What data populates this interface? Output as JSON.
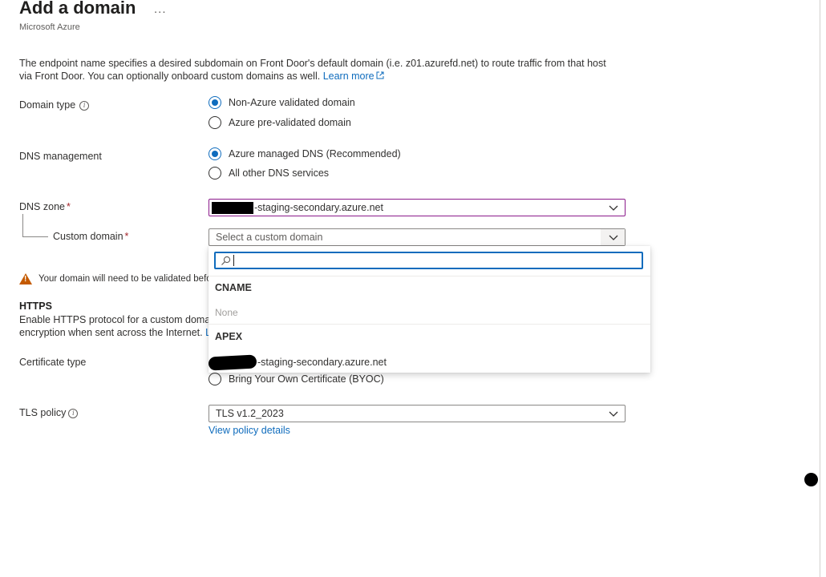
{
  "header": {
    "title": "Add a domain",
    "more_label": "...",
    "subtitle": "Microsoft Azure"
  },
  "description": {
    "text": "The endpoint name specifies a desired subdomain on Front Door's default domain (i.e. z01.azurefd.net) to route traffic from that host via Front Door. You can optionally onboard custom domains as well.",
    "learn_more": "Learn more"
  },
  "domain_type": {
    "label": "Domain type",
    "options": [
      "Non-Azure validated domain",
      "Azure pre-validated domain"
    ],
    "selected": "Non-Azure validated domain"
  },
  "dns_management": {
    "label": "DNS management",
    "options": [
      "Azure managed DNS (Recommended)",
      "All other DNS services"
    ],
    "selected": "Azure managed DNS (Recommended)"
  },
  "dns_zone": {
    "label": "DNS zone",
    "required_mark": "*",
    "value_suffix": "-staging-secondary.azure.net"
  },
  "custom_domain": {
    "label": "Custom domain",
    "required_mark": "*",
    "placeholder": "Select a custom domain",
    "dropdown": {
      "search_placeholder": "",
      "groups": [
        {
          "name": "CNAME",
          "items": [],
          "empty_text": "None"
        },
        {
          "name": "APEX",
          "items": [
            "-staging-secondary.azure.net"
          ]
        }
      ]
    }
  },
  "warning": {
    "text": "Your domain will need to be validated befo"
  },
  "https": {
    "heading": "HTTPS",
    "line1": "Enable HTTPS protocol for a custom domai",
    "line2": "encryption when sent across the Internet.",
    "link_fragment": "Le"
  },
  "certificate_type": {
    "label": "Certificate type",
    "options": [
      "Bring Your Own Certificate (BYOC)"
    ]
  },
  "tls_policy": {
    "label": "TLS policy",
    "value": "TLS v1.2_2023",
    "link": "View policy details"
  },
  "colors": {
    "accent": "#0f6cbd",
    "focus_border": "#8b1a8b",
    "warning": "#c45a00",
    "required": "#a4262c"
  }
}
